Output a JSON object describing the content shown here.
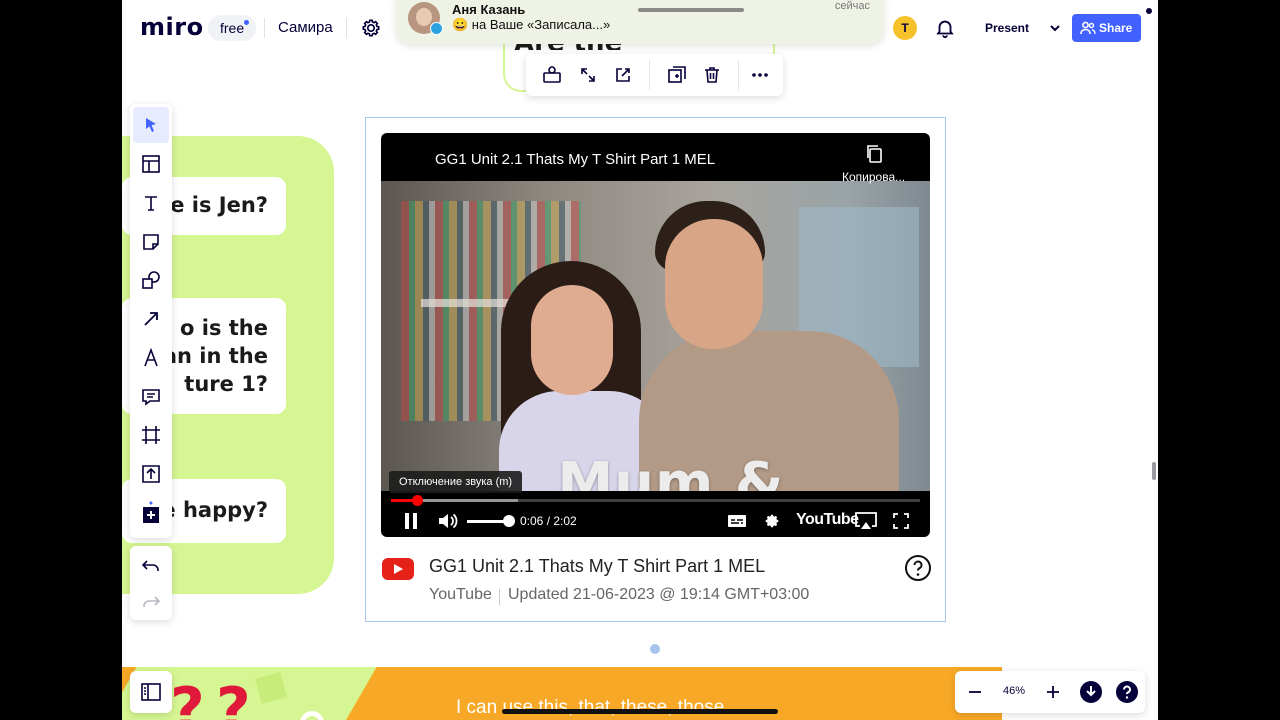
{
  "app": {
    "logo": "miro",
    "plan": "free",
    "board_name": "Самира",
    "avatar_initial": "T",
    "present_label": "Present",
    "share_label": "Share",
    "accent_color": "#4262ff",
    "avatar_color": "#f5c22b"
  },
  "notification": {
    "sender": "Аня Казань",
    "message": "😀 на Ваше «Записала...»",
    "time": "сейчас"
  },
  "questions": [
    {
      "text": "W  re is Jen?"
    },
    {
      "line1": "  o is the",
      "line2": "w  an in the",
      "line3": "   ture 1?"
    },
    {
      "text": "s   e happy?"
    }
  ],
  "frame": {
    "partial_title": "Are the"
  },
  "toolbar": {
    "tools": [
      "select-cursor-icon",
      "templates-icon",
      "text-icon",
      "sticky-note-icon",
      "shapes-icon",
      "arrow-icon",
      "pen-icon",
      "comment-icon",
      "frame-icon",
      "upload-icon",
      "more-tools-icon"
    ],
    "undo": "undo-icon",
    "redo": "redo-icon"
  },
  "context_toolbar": [
    "replace-icon",
    "fullscreen-icon",
    "open-external-icon",
    "duplicate-icon",
    "delete-icon",
    "more-icon"
  ],
  "video": {
    "title": "GG1 Unit 2.1 Thats My T Shirt Part 1 MEL",
    "copy_label": "Копирова...",
    "overlay_text": "Mum & Dad",
    "tooltip": "Отключение звука (m)",
    "current_time": "0:06",
    "duration": "2:02",
    "time_display": "0:06 / 2:02",
    "played_percent": 5,
    "buffered_percent": 24,
    "volume_percent": 85,
    "brand": "YouTube"
  },
  "embed_meta": {
    "title": "GG1 Unit 2.1 Thats My T Shirt Part 1 MEL",
    "source": "YouTube",
    "updated": "Updated 21-06-2023 @ 19:14 GMT+03:00"
  },
  "banner": {
    "q1": "?",
    "q2": "?",
    "text": "I can use this, that, these, those"
  },
  "zoom": {
    "value": "46%"
  }
}
